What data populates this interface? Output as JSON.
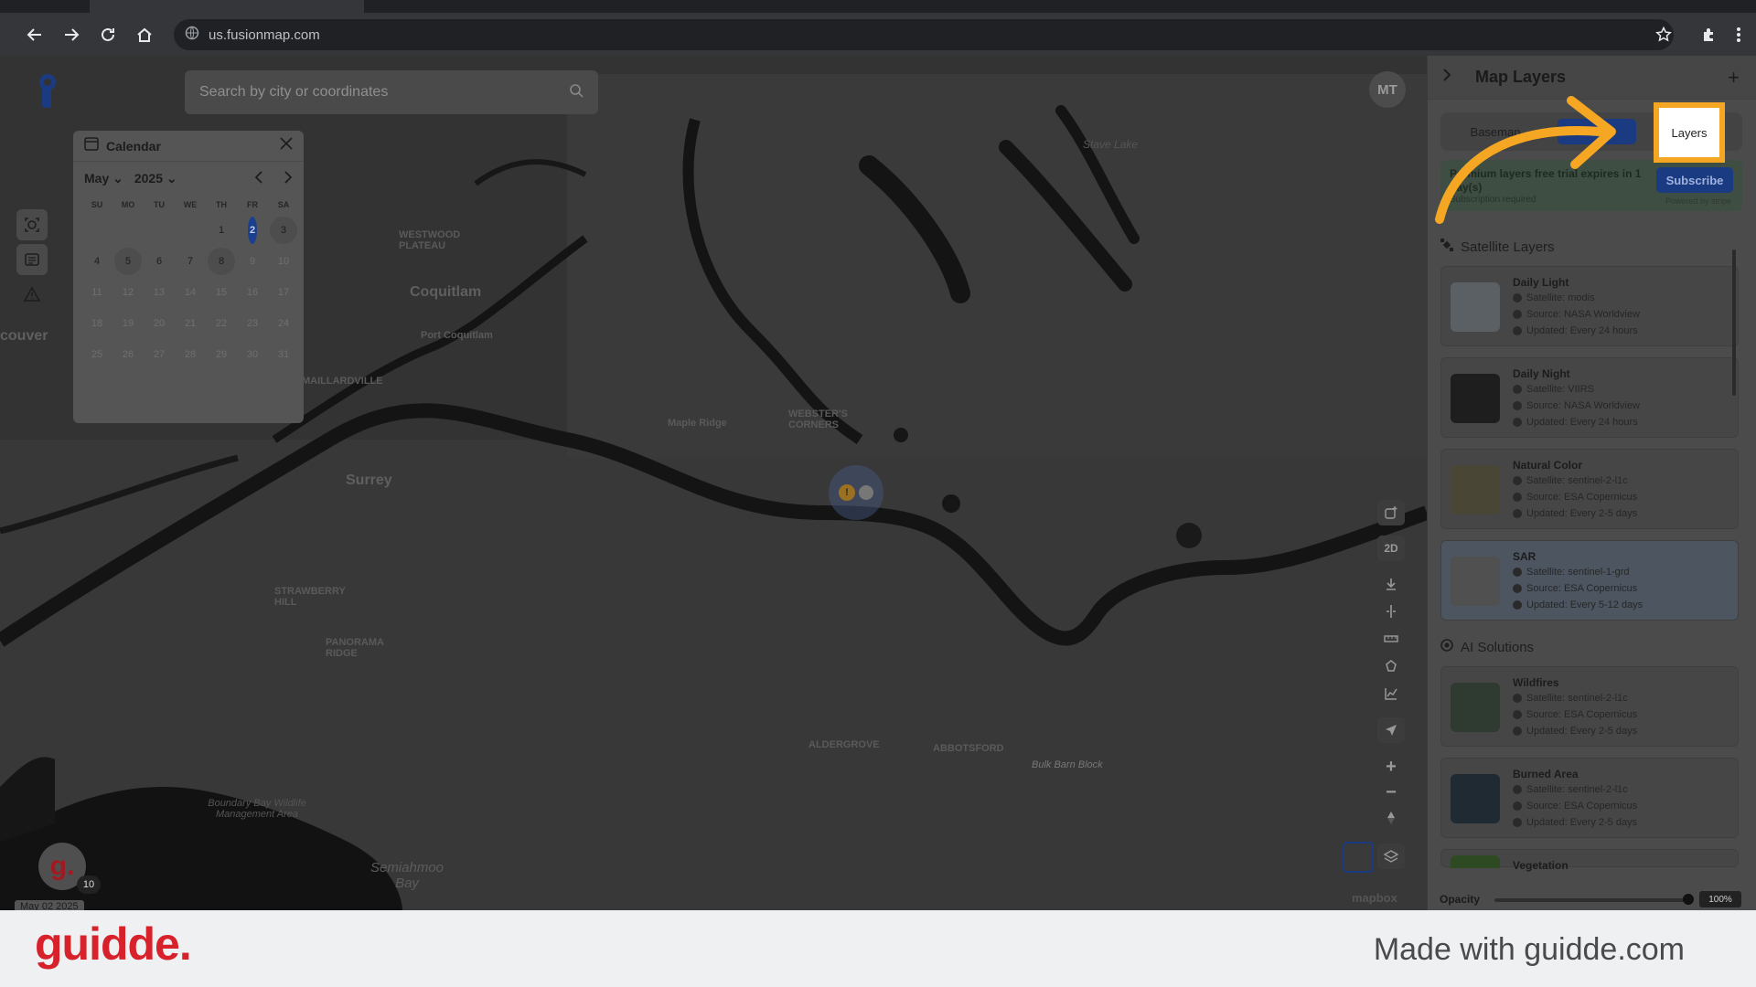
{
  "browser": {
    "url": "us.fusionmap.com"
  },
  "search": {
    "placeholder": "Search by city or coordinates"
  },
  "user": {
    "initials": "MT"
  },
  "calendar": {
    "title": "Calendar",
    "month": "May",
    "year": "2025",
    "weekdays": [
      "SU",
      "MO",
      "TU",
      "WE",
      "TH",
      "FR",
      "SA"
    ],
    "days": [
      {
        "d": "",
        "s": "empty"
      },
      {
        "d": "",
        "s": "empty"
      },
      {
        "d": "",
        "s": "empty"
      },
      {
        "d": "",
        "s": "empty"
      },
      {
        "d": "1",
        "s": "normal"
      },
      {
        "d": "2",
        "s": "selected"
      },
      {
        "d": "3",
        "s": "has"
      },
      {
        "d": "4",
        "s": "normal"
      },
      {
        "d": "5",
        "s": "has"
      },
      {
        "d": "6",
        "s": "normal"
      },
      {
        "d": "7",
        "s": "normal"
      },
      {
        "d": "8",
        "s": "has"
      },
      {
        "d": "9",
        "s": "dim"
      },
      {
        "d": "10",
        "s": "dim"
      },
      {
        "d": "11",
        "s": "dim"
      },
      {
        "d": "12",
        "s": "dim"
      },
      {
        "d": "13",
        "s": "dim"
      },
      {
        "d": "14",
        "s": "dim"
      },
      {
        "d": "15",
        "s": "dim"
      },
      {
        "d": "16",
        "s": "dim"
      },
      {
        "d": "17",
        "s": "dim"
      },
      {
        "d": "18",
        "s": "dim"
      },
      {
        "d": "19",
        "s": "dim"
      },
      {
        "d": "20",
        "s": "dim"
      },
      {
        "d": "21",
        "s": "dim"
      },
      {
        "d": "22",
        "s": "dim"
      },
      {
        "d": "23",
        "s": "dim"
      },
      {
        "d": "24",
        "s": "dim"
      },
      {
        "d": "25",
        "s": "dim"
      },
      {
        "d": "26",
        "s": "dim"
      },
      {
        "d": "27",
        "s": "dim"
      },
      {
        "d": "28",
        "s": "dim"
      },
      {
        "d": "29",
        "s": "dim"
      },
      {
        "d": "30",
        "s": "dim"
      },
      {
        "d": "31",
        "s": "dim"
      }
    ]
  },
  "map_labels": {
    "westwood": "WESTWOOD PLATEAU",
    "coquitlam": "Coquitlam",
    "port_coquitlam": "Port Coquitlam",
    "maillardville": "MAILLARDVILLE",
    "surrey": "Surrey",
    "websters_corners": "WEBSTER'S CORNERS",
    "maple_ridge": "Maple Ridge",
    "strawberry_hill": "STRAWBERRY HILL",
    "panorama_ridge": "PANORAMA RIDGE",
    "aldergrove": "ALDERGROVE",
    "abbotsford": "ABBOTSFORD",
    "bulk_barn": "Bulk Barn Block",
    "boundary_bay": "Boundary Bay Wildlife Management Area",
    "semiahmoo": "Semiahmoo Bay",
    "couver": "couver",
    "stave_lake": "Stave Lake",
    "mapbox": "mapbox",
    "map_date": "May 02 2025"
  },
  "map_controls": {
    "mode": "2D"
  },
  "panel": {
    "title": "Map Layers",
    "tabs": {
      "basemap": "Basemap",
      "custom": "m",
      "layers": "Layers"
    },
    "trial": {
      "text": "Premium layers free trial expires in 1 day(s)",
      "sub": "Subscription required",
      "button": "Subscribe",
      "powered": "Powered by stripe"
    },
    "satellite_section": "Satellite Layers",
    "ai_section": "AI Solutions",
    "satellite_layers": [
      {
        "name": "Daily Light",
        "satellite": "Satellite: modis",
        "source": "Source: NASA Worldview",
        "updated": "Updated: Every 24 hours"
      },
      {
        "name": "Daily Night",
        "satellite": "Satellite: VIIRS",
        "source": "Source: NASA Worldview",
        "updated": "Updated: Every 24 hours"
      },
      {
        "name": "Natural Color",
        "satellite": "Satellite: sentinel-2-l1c",
        "source": "Source: ESA Copernicus",
        "updated": "Updated: Every 2-5 days"
      },
      {
        "name": "SAR",
        "satellite": "Satellite: sentinel-1-grd",
        "source": "Source: ESA Copernicus",
        "updated": "Updated: Every 5-12 days"
      }
    ],
    "ai_layers": [
      {
        "name": "Wildfires",
        "satellite": "Satellite: sentinel-2-l1c",
        "source": "Source: ESA Copernicus",
        "updated": "Updated: Every 2-5 days"
      },
      {
        "name": "Burned Area",
        "satellite": "Satellite: sentinel-2-l1c",
        "source": "Source: ESA Copernicus",
        "updated": "Updated: Every 2-5 days"
      },
      {
        "name": "Vegetation",
        "satellite": "",
        "source": "",
        "updated": ""
      }
    ],
    "opacity": {
      "label": "Opacity",
      "value": "100%",
      "fraction": 1.0
    }
  },
  "guidde": {
    "badge": "g.",
    "count": "10",
    "brand": "guidde.",
    "made_with": "Made with guidde.com"
  },
  "colors": {
    "highlight": "#f5a623",
    "brand_red": "#d8222b",
    "selected_day": "#1a3f8f"
  }
}
